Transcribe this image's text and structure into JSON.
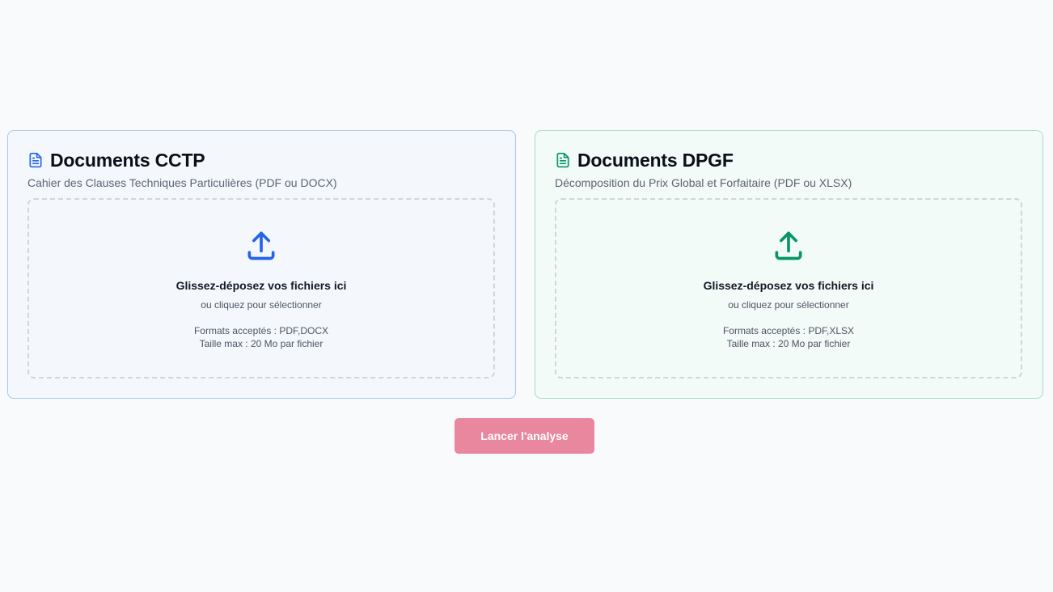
{
  "colors": {
    "cctp_accent": "#2563eb",
    "dpgf_accent": "#059669",
    "button_bg": "#e8879d"
  },
  "cctp": {
    "icon": "document-icon",
    "title": "Documents CCTP",
    "subtitle": "Cahier des Clauses Techniques Particulières (PDF ou DOCX)",
    "dropzone": {
      "icon": "upload-icon",
      "main": "Glissez-déposez vos fichiers ici",
      "alt": "ou cliquez pour sélectionner",
      "formats": "Formats acceptés : PDF,DOCX",
      "size": "Taille max : 20 Mo par fichier"
    }
  },
  "dpgf": {
    "icon": "document-icon",
    "title": "Documents DPGF",
    "subtitle": "Décomposition du Prix Global et Forfaitaire (PDF ou XLSX)",
    "dropzone": {
      "icon": "upload-icon",
      "main": "Glissez-déposez vos fichiers ici",
      "alt": "ou cliquez pour sélectionner",
      "formats": "Formats acceptés : PDF,XLSX",
      "size": "Taille max : 20 Mo par fichier"
    }
  },
  "actions": {
    "launch_label": "Lancer l'analyse"
  }
}
